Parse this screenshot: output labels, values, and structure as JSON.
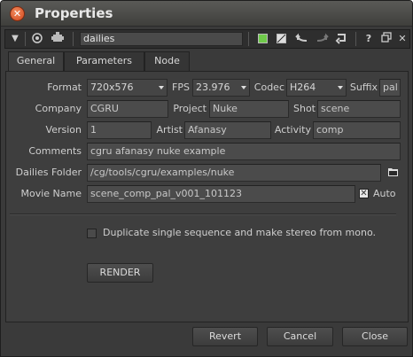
{
  "window": {
    "title": "Properties",
    "close_glyph": "✕"
  },
  "toolbar": {
    "collapse_glyph": "▼",
    "node_name": "dailies",
    "help_glyph": "?",
    "float_glyph": "▫",
    "close_glyph": "✕"
  },
  "tabs": [
    {
      "label": "General",
      "active": true
    },
    {
      "label": "Parameters",
      "active": false
    },
    {
      "label": "Node",
      "active": false
    }
  ],
  "form": {
    "format": {
      "label": "Format",
      "value": "720x576"
    },
    "fps": {
      "label": "FPS",
      "value": "23.976"
    },
    "codec": {
      "label": "Codec",
      "value": "H264"
    },
    "suffix": {
      "label": "Suffix",
      "value": "pal"
    },
    "company": {
      "label": "Company",
      "value": "CGRU"
    },
    "project": {
      "label": "Project",
      "value": "Nuke"
    },
    "shot": {
      "label": "Shot",
      "value": "scene"
    },
    "version": {
      "label": "Version",
      "value": "1"
    },
    "artist": {
      "label": "Artist",
      "value": "Afanasy"
    },
    "activity": {
      "label": "Activity",
      "value": "comp"
    },
    "comments": {
      "label": "Comments",
      "value": "cgru afanasy nuke example"
    },
    "dailies_folder": {
      "label": "Dailies Folder",
      "value": "/cg/tools/cgru/examples/nuke"
    },
    "movie_name": {
      "label": "Movie Name",
      "value": "scene_comp_pal_v001_101123"
    },
    "auto": {
      "label": "Auto",
      "checked": true
    },
    "stereo": {
      "label": "Duplicate single sequence and make stereo from mono.",
      "checked": false
    },
    "render_label": "RENDER"
  },
  "footer": {
    "revert_label": "Revert",
    "cancel_label": "Cancel",
    "close_label": "Close"
  },
  "colors": {
    "accent_green": "#6fca4a",
    "close_orange": "#d2481e"
  }
}
